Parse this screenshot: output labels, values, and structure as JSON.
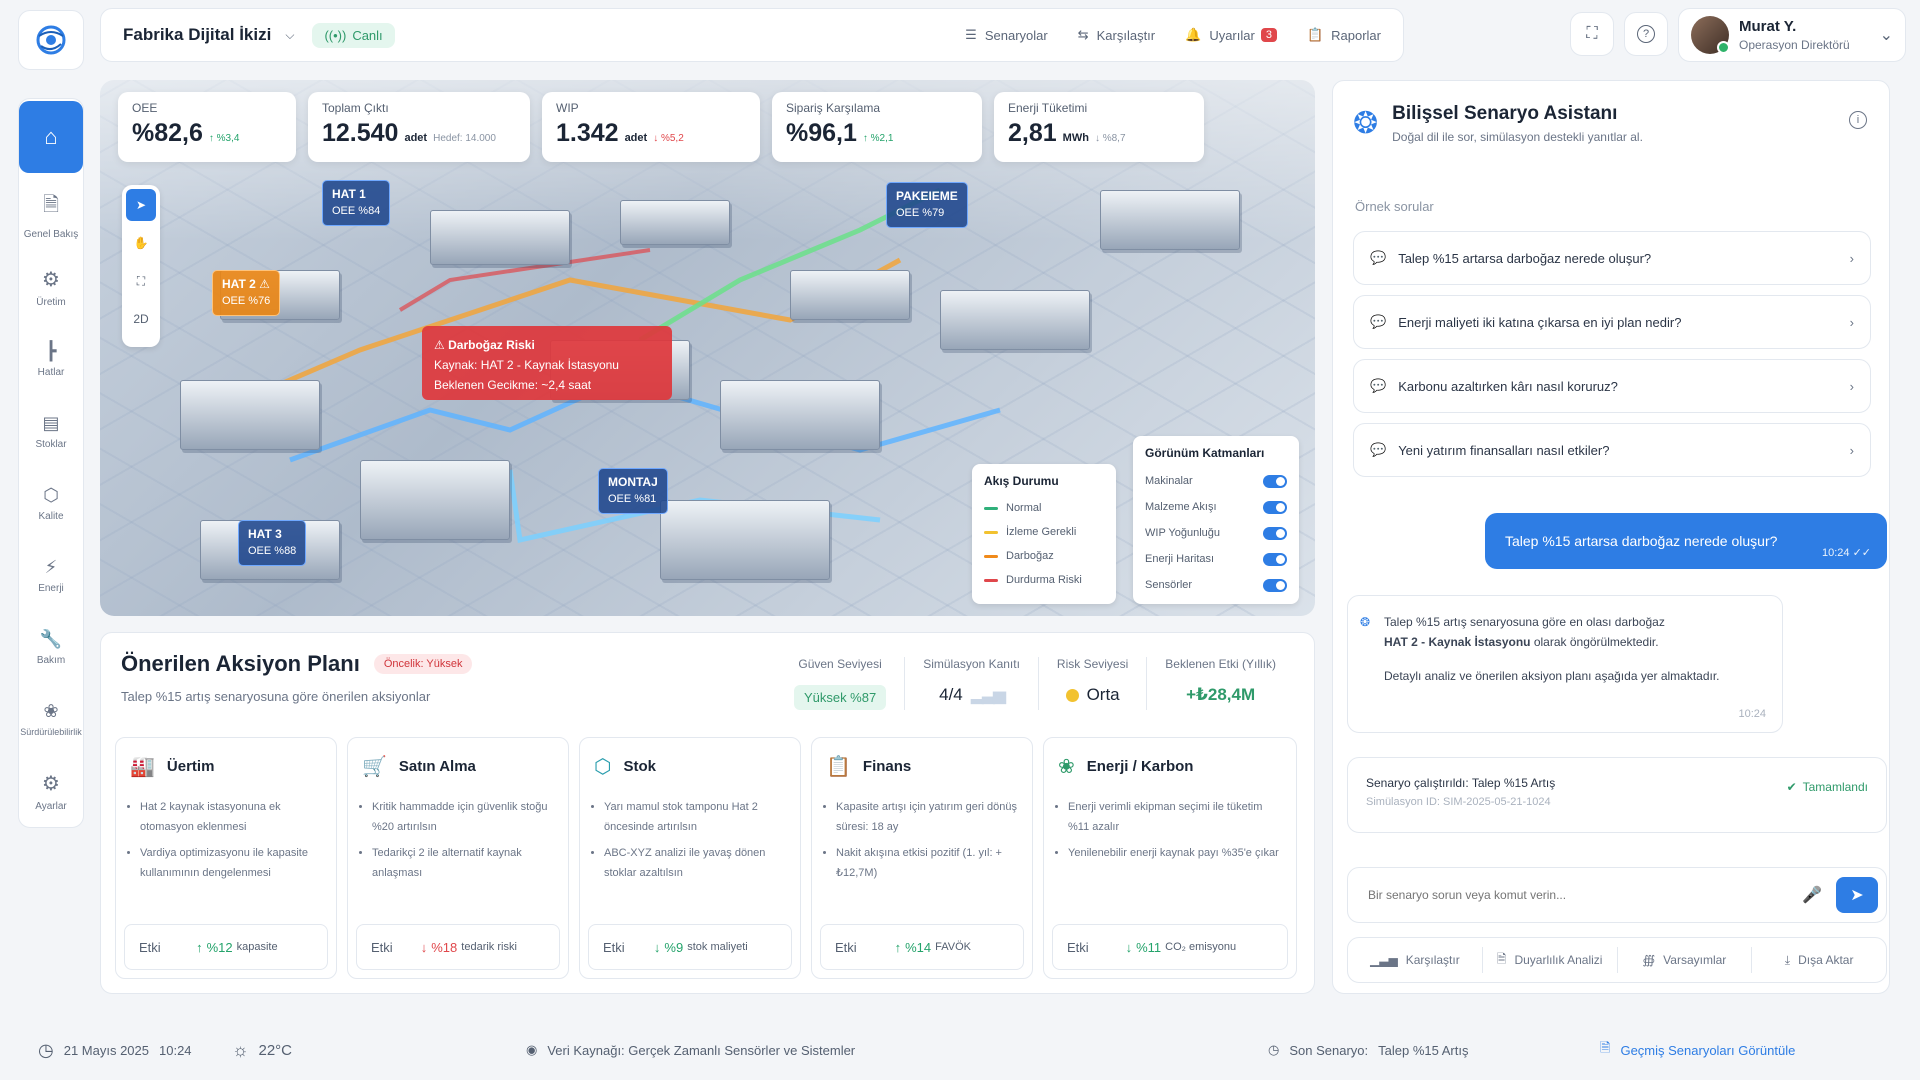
{
  "topbar": {
    "title": "Fabrika Dijital İkizi",
    "live": "Canlı",
    "nav": [
      {
        "label": "Senaryolar",
        "icon": "layers-icon"
      },
      {
        "label": "Karşılaştır",
        "icon": "compare-icon"
      },
      {
        "label": "Uyarılar",
        "icon": "bell-icon",
        "badge": "3"
      },
      {
        "label": "Raporlar",
        "icon": "report-icon"
      }
    ]
  },
  "user": {
    "name": "Murat Y.",
    "role": "Operasyon Direktörü"
  },
  "sidebar": [
    {
      "label": "",
      "icon": "home-icon"
    },
    {
      "label": "Genel Bakış",
      "icon": "document-icon"
    },
    {
      "label": "Üretim",
      "icon": "gear-icon"
    },
    {
      "label": "Hatlar",
      "icon": "tree-icon"
    },
    {
      "label": "Stoklar",
      "icon": "stack-icon"
    },
    {
      "label": "Kalite",
      "icon": "shield-icon"
    },
    {
      "label": "Enerji",
      "icon": "bolt-icon"
    },
    {
      "label": "Bakım",
      "icon": "wrench-icon"
    },
    {
      "label": "Sürdürülebilirlik",
      "icon": "leaf-icon"
    },
    {
      "label": "Ayarlar",
      "icon": "settings-icon"
    }
  ],
  "kpis": [
    {
      "label": "OEE",
      "value": "%82,6",
      "unit": "",
      "delta": "↑ %3,4",
      "trend": "up"
    },
    {
      "label": "Toplam Çıktı",
      "value": "12.540",
      "unit": "adet",
      "delta": "Hedef: 14.000",
      "trend": "muted"
    },
    {
      "label": "WIP",
      "value": "1.342",
      "unit": "adet",
      "delta": "↓ %5,2",
      "trend": "down"
    },
    {
      "label": "Sipariş Karşılama",
      "value": "%96,1",
      "unit": "",
      "delta": "↑ %2,1",
      "trend": "up"
    },
    {
      "label": "Enerji Tüketimi",
      "value": "2,81",
      "unit": "MWh",
      "delta": "↓ %8,7",
      "trend": "muted"
    }
  ],
  "map": {
    "tool_2d": "2D",
    "tags": [
      {
        "name": "HAT 1",
        "oee": "OEE %84"
      },
      {
        "name": "HAT 2",
        "oee": "OEE %76"
      },
      {
        "name": "HAT 3",
        "oee": "OEE %88"
      },
      {
        "name": "MONTAJ",
        "oee": "OEE %81"
      },
      {
        "name": "PAKEIEME",
        "oee": "OEE %79"
      }
    ],
    "alert": {
      "title": "Darboğaz Riski",
      "source": "Kaynak: HAT 2 - Kaynak İstasyonu",
      "delay": "Beklenen Gecikme: ~2,4 saat"
    },
    "legend": {
      "title": "Akış Durumu",
      "items": [
        {
          "label": "Normal",
          "color": "#2fb07a"
        },
        {
          "label": "İzleme Gerekli",
          "color": "#f2c230"
        },
        {
          "label": "Darboğaz",
          "color": "#f08a1a"
        },
        {
          "label": "Durdurma Riski",
          "color": "#e0474b"
        }
      ]
    },
    "layers": {
      "title": "Görünüm Katmanları",
      "items": [
        "Makinalar",
        "Malzeme Akışı",
        "WIP Yoğunluğu",
        "Enerji Haritası",
        "Sensörler"
      ]
    }
  },
  "plan": {
    "title": "Önerilen Aksiyon Planı",
    "priority": "Öncelik: Yüksek",
    "subtitle": "Talep %15 artış senaryosuna göre önerilen aksiyonlar",
    "metrics": [
      {
        "label": "Güven Seviyesi",
        "value": "Yüksek  %87"
      },
      {
        "label": "Simülasyon Kanıtı",
        "value": "4/4"
      },
      {
        "label": "Risk Seviyesi",
        "value": "Orta"
      },
      {
        "label": "Beklenen Etki (Yıllık)",
        "value": "+₺28,4M"
      }
    ],
    "cards": [
      {
        "title": "Üertim",
        "icon": "factory-icon",
        "bullets": [
          "Hat 2 kaynak istasyonuna ek otomasyon eklenmesi",
          "Vardiya optimizasyonu ile kapasite kullanımının dengelenmesi"
        ],
        "effect_label": "Etki",
        "arrow": "↑",
        "effect": "%12",
        "effect_unit": "kapasite",
        "trend": "up"
      },
      {
        "title": "Satın Alma",
        "icon": "cart-icon",
        "bullets": [
          "Kritik hammadde için güvenlik stoğu %20 artırılsın",
          "Tedarikçi 2 ile alternatif kaynak anlaşması"
        ],
        "effect_label": "Etki",
        "arrow": "↓",
        "effect": "%18",
        "effect_unit": "tedarik riski",
        "trend": "down"
      },
      {
        "title": "Stok",
        "icon": "box-icon",
        "bullets": [
          "Yarı mamul stok tamponu Hat 2 öncesinde artırılsın",
          "ABC-XYZ analizi ile yavaş dönen stoklar azaltılsın"
        ],
        "effect_label": "Etki",
        "arrow": "↓",
        "effect": "%9",
        "effect_unit": "stok maliyeti",
        "trend": "up"
      },
      {
        "title": "Finans",
        "icon": "clipboard-icon",
        "bullets": [
          "Kapasite artışı için yatırım geri dönüş süresi: 18 ay",
          "Nakit akışına etkisi pozitif (1. yıl: +₺12,7M)"
        ],
        "effect_label": "Etki",
        "arrow": "↑",
        "effect": "%14",
        "effect_unit": "FAVÖK",
        "trend": "up"
      },
      {
        "title": "Enerji / Karbon",
        "icon": "leaf-icon",
        "bullets": [
          "Enerji verimli ekipman seçimi ile tüketim %11 azalır",
          "Yenilenebilir enerji kaynak payı %35'e çıkar"
        ],
        "effect_label": "Etki",
        "arrow": "↓",
        "effect": "%11",
        "effect_unit": "CO₂ emisyonu",
        "trend": "up"
      }
    ]
  },
  "assistant": {
    "title": "Bilişsel Senaryo Asistanı",
    "subtitle": "Doğal dil ile sor, simülasyon destekli yanıtlar al.",
    "examples_label": "Örnek sorular",
    "questions": [
      "Talep %15 artarsa darboğaz nerede oluşur?",
      "Enerji maliyeti iki katına çıkarsa en iyi plan nedir?",
      "Karbonu azaltırken kârı nasıl koruruz?",
      "Yeni yatırım finansalları nasıl etkiler?"
    ],
    "user_msg": "Talep %15 artarsa darboğaz nerede oluşur?",
    "user_time": "10:24",
    "bot_line1": "Talep %15 artış senaryosuna göre en olası darboğaz",
    "bot_bold": "HAT 2 - Kaynak İstasyonu",
    "bot_line2": "olarak öngörülmektedir.",
    "bot_line3": "Detaylı analiz ve önerilen aksiyon planı aşağıda yer almaktadır.",
    "bot_time": "10:24",
    "run_title": "Senaryo çalıştırıldı: Talep %15 Artış",
    "run_id": "Simülasyon ID: SIM-2025-05-21-1024",
    "run_status": "Tamamlandı",
    "input_placeholder": "Bir senaryo sorun veya komut verin...",
    "actions": [
      "Karşılaştır",
      "Duyarlılık Analizi",
      "Varsayımlar",
      "Dışa Aktar"
    ]
  },
  "footer": {
    "date": "21 Mayıs 2025",
    "time": "10:24",
    "temp": "22°C",
    "source": "Veri Kaynağı: Gerçek Zamanlı Sensörler ve Sistemler",
    "last_label": "Son Senaryo:",
    "last_value": "Talep %15 Artış",
    "history": "Geçmiş Senaryoları Görüntüle"
  }
}
